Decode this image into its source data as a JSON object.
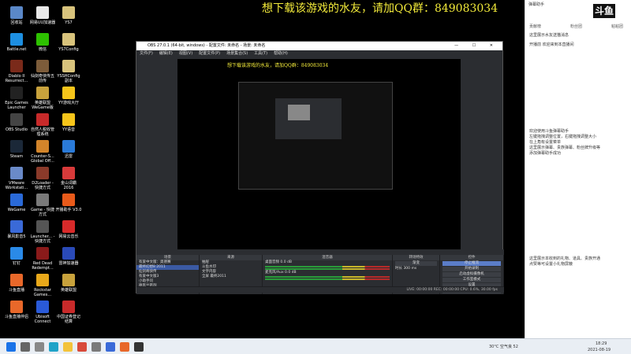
{
  "banner": "想下载该游戏的水友，请加QQ群：849083034",
  "desktop": {
    "icons": [
      {
        "label": "回收站",
        "color": "#5a88c8"
      },
      {
        "label": "网易UU加速器",
        "color": "#e8e8e8"
      },
      {
        "label": "YS7",
        "color": "#d8c37c"
      },
      {
        "label": "Battle.net",
        "color": "#1d8fe1"
      },
      {
        "label": "微信",
        "color": "#2dc100"
      },
      {
        "label": "YS7Config",
        "color": "#d8c37c"
      },
      {
        "label": "Diablo II Resurrect...",
        "color": "#7a2a1a"
      },
      {
        "label": "仙剑奇侠传五前传",
        "color": "#7d5c3a"
      },
      {
        "label": "YSSHConfig 副本",
        "color": "#d8c37c"
      },
      {
        "label": "Epic Games Launcher",
        "color": "#222222"
      },
      {
        "label": "英雄联盟 WeGame版",
        "color": "#c8a23c"
      },
      {
        "label": "YY游戏大厅",
        "color": "#f6c51a"
      },
      {
        "label": "OBS Studio",
        "color": "#444444"
      },
      {
        "label": "自然人税收管理系统",
        "color": "#c82a2a"
      },
      {
        "label": "YY语音",
        "color": "#f6c51a"
      },
      {
        "label": "Steam",
        "color": "#1b2838"
      },
      {
        "label": "Counter-S... Global Off...",
        "color": "#d2842a"
      },
      {
        "label": "迅雷",
        "color": "#2a7ad8"
      },
      {
        "label": "VMware Workstati...",
        "color": "#6a8ac8"
      },
      {
        "label": "D2Loader - 快捷方式",
        "color": "#8a3a2a"
      },
      {
        "label": "金山词霸 2016",
        "color": "#d83a3a"
      },
      {
        "label": "WeGame",
        "color": "#2a6ad8"
      },
      {
        "label": "Game - 快捷方式",
        "color": "#7a7a7a"
      },
      {
        "label": "开播助手 V3.0",
        "color": "#e85a1a"
      },
      {
        "label": "暴风影音5",
        "color": "#3a6ad8"
      },
      {
        "label": "Launcher... - 快捷方式",
        "color": "#555555"
      },
      {
        "label": "网易云音乐",
        "color": "#d82a2a"
      },
      {
        "label": "钉钉",
        "color": "#2a8ae8"
      },
      {
        "label": "Red Dead Redempt...",
        "color": "#8a1a1a"
      },
      {
        "label": "雷神加速器",
        "color": "#2a4ab8"
      },
      {
        "label": "斗鱼直播",
        "color": "#e8682a"
      },
      {
        "label": "Rockstar Games...",
        "color": "#e8a81a"
      },
      {
        "label": "英雄联盟",
        "color": "#c8a23c"
      },
      {
        "label": "斗鱼直播伴侣",
        "color": "#e8682a"
      },
      {
        "label": "Ubisoft Connect",
        "color": "#2a5ad8"
      },
      {
        "label": "中国证券登记结算",
        "color": "#c82a2a"
      }
    ]
  },
  "obs": {
    "title": "OBS 27.0.1 (64-bit, windows) - 配置文件: 未命名 - 场景: 未命名",
    "window_controls": "— ☐ ✕",
    "menu": [
      "文件(F)",
      "编辑(E)",
      "视图(V)",
      "配置文件(P)",
      "场景集合(S)",
      "工具(T)",
      "帮助(H)"
    ],
    "inner_banner": "想下载该游戏的水友，请加QQ群：849083034",
    "source_bar": "未选择源",
    "scenes": {
      "title": "场景",
      "items": [
        "有爱中文版：奥德赛",
        "最终幻想8 2011",
        "仙剑奇侠传",
        "有爱中文版3",
        "小助手问",
        "德黑兰密剂"
      ]
    },
    "sources": {
      "title": "来源",
      "items": [
        "抽屉",
        "斗鱼水印",
        "文字内容",
        "全屏 最终2011"
      ]
    },
    "mixer": {
      "title": "混音器",
      "channels": [
        {
          "name": "桌面音频",
          "level": "0.0 dB"
        },
        {
          "name": "麦克风/Aux",
          "level": "0.0 dB"
        }
      ]
    },
    "transition": {
      "title": "转场特效",
      "type": "渐变",
      "duration_label": "时长",
      "duration": "300 ms"
    },
    "controls": {
      "title": "控件",
      "buttons": [
        "停止推流",
        "开始录制",
        "启动虚拟摄像机",
        "工作室模式",
        "设置",
        "退出"
      ]
    },
    "status": "LIVE: 00:00:00   REC: 00:00:00   CPU: 0.6%, 30.00 fps"
  },
  "chat": {
    "header": "弹幕助手",
    "logo": "斗鱼",
    "tabs": [
      "贡献榜",
      "粉丝团",
      "粘粘团"
    ],
    "messages": [
      "这里展示水友送猫消息",
      "开播前 欢迎来到本直播间",
      "欢迎使用斗鱼弹幕助手",
      "左键拖拽调整位置，右键拖拽调整大小",
      "在上角有设置菜单",
      "这里展示弹幕、贵族弹幕、粉丝牌升级等",
      "添加弹幕助手成功",
      "这里展示本收到的礼物、道具、贵族开通",
      "点赞等可设置小礼物屏蔽"
    ]
  },
  "taskbar": {
    "weather": "30°C 空气良 52",
    "time": "18:29",
    "date": "2021-08-19",
    "apps": [
      {
        "name": "start",
        "color": "#1a73e8"
      },
      {
        "name": "search",
        "color": "#666666"
      },
      {
        "name": "task-view",
        "color": "#888888"
      },
      {
        "name": "edge",
        "color": "#1fa3c8"
      },
      {
        "name": "explorer",
        "color": "#f3c33a"
      },
      {
        "name": "chrome",
        "color": "#d84a3a"
      },
      {
        "name": "app1",
        "color": "#7a7a7a"
      },
      {
        "name": "app2",
        "color": "#3a6ad8"
      },
      {
        "name": "app3",
        "color": "#e8682a"
      },
      {
        "name": "obs",
        "color": "#333333"
      }
    ]
  }
}
